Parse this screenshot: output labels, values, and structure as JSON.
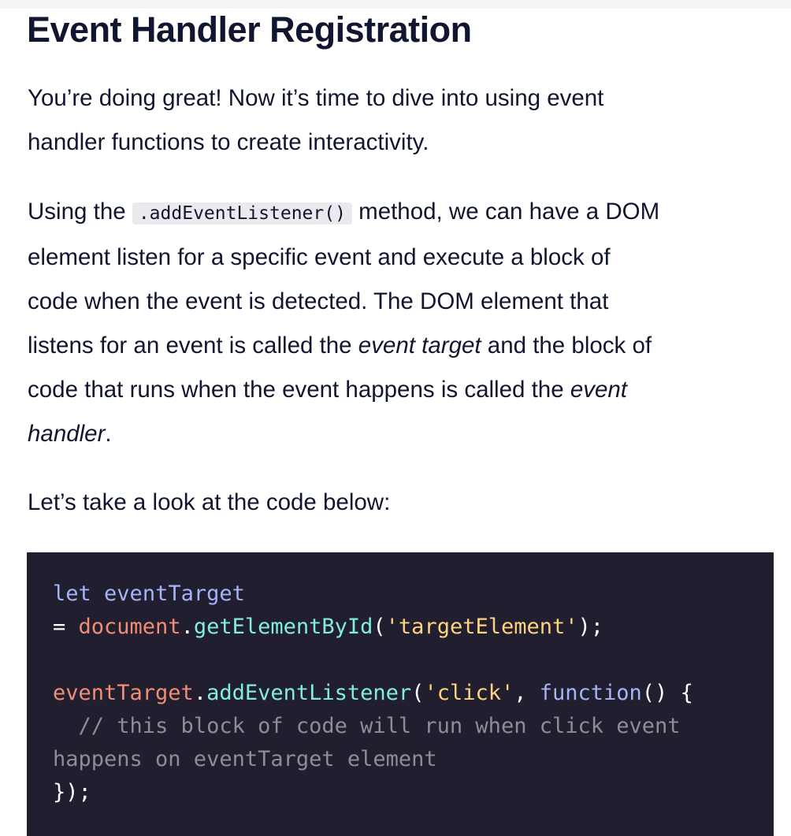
{
  "title": "Event Handler Registration",
  "intro": {
    "lines": [
      "You’re doing great! Now it’s time to dive into using event",
      "handler functions to create interactivity."
    ]
  },
  "para2": {
    "l1_pre": "Using the ",
    "inline_code": ".addEventListener()",
    "l1_post": " method, we can have a DOM",
    "l2": "element listen for a specific event and execute a block of",
    "l3": "code when the event is detected. The DOM element that",
    "l4_pre": "listens for an event is called the ",
    "l4_em": "event target",
    "l4_post": " and the block of",
    "l5_pre": "code that runs when the event happens is called the ",
    "l5_em": "event",
    "l6_em": "handler",
    "l6_post": "."
  },
  "para3": "Let’s take a look at the code below:",
  "code": {
    "l1": {
      "kw": "let",
      "sp": " ",
      "var": "eventTarget"
    },
    "l2": {
      "eq": "= ",
      "obj": "document",
      "dot": ".",
      "fn": "getElementById",
      "open": "(",
      "str": "'targetElement'",
      "close": ");"
    },
    "l4": {
      "obj": "eventTarget",
      "dot": ".",
      "fn": "addEventListener",
      "open": "(",
      "str": "'click'",
      "comma": ", ",
      "kw": "function",
      "rest": "() {"
    },
    "l5": "  // this block of code will run when click event",
    "l6": "happens on eventTarget element",
    "l7": "});"
  },
  "colors": {
    "code_bg": "#211f2f",
    "inline_code_bg": "#eaeaee",
    "text": "#10162f"
  }
}
